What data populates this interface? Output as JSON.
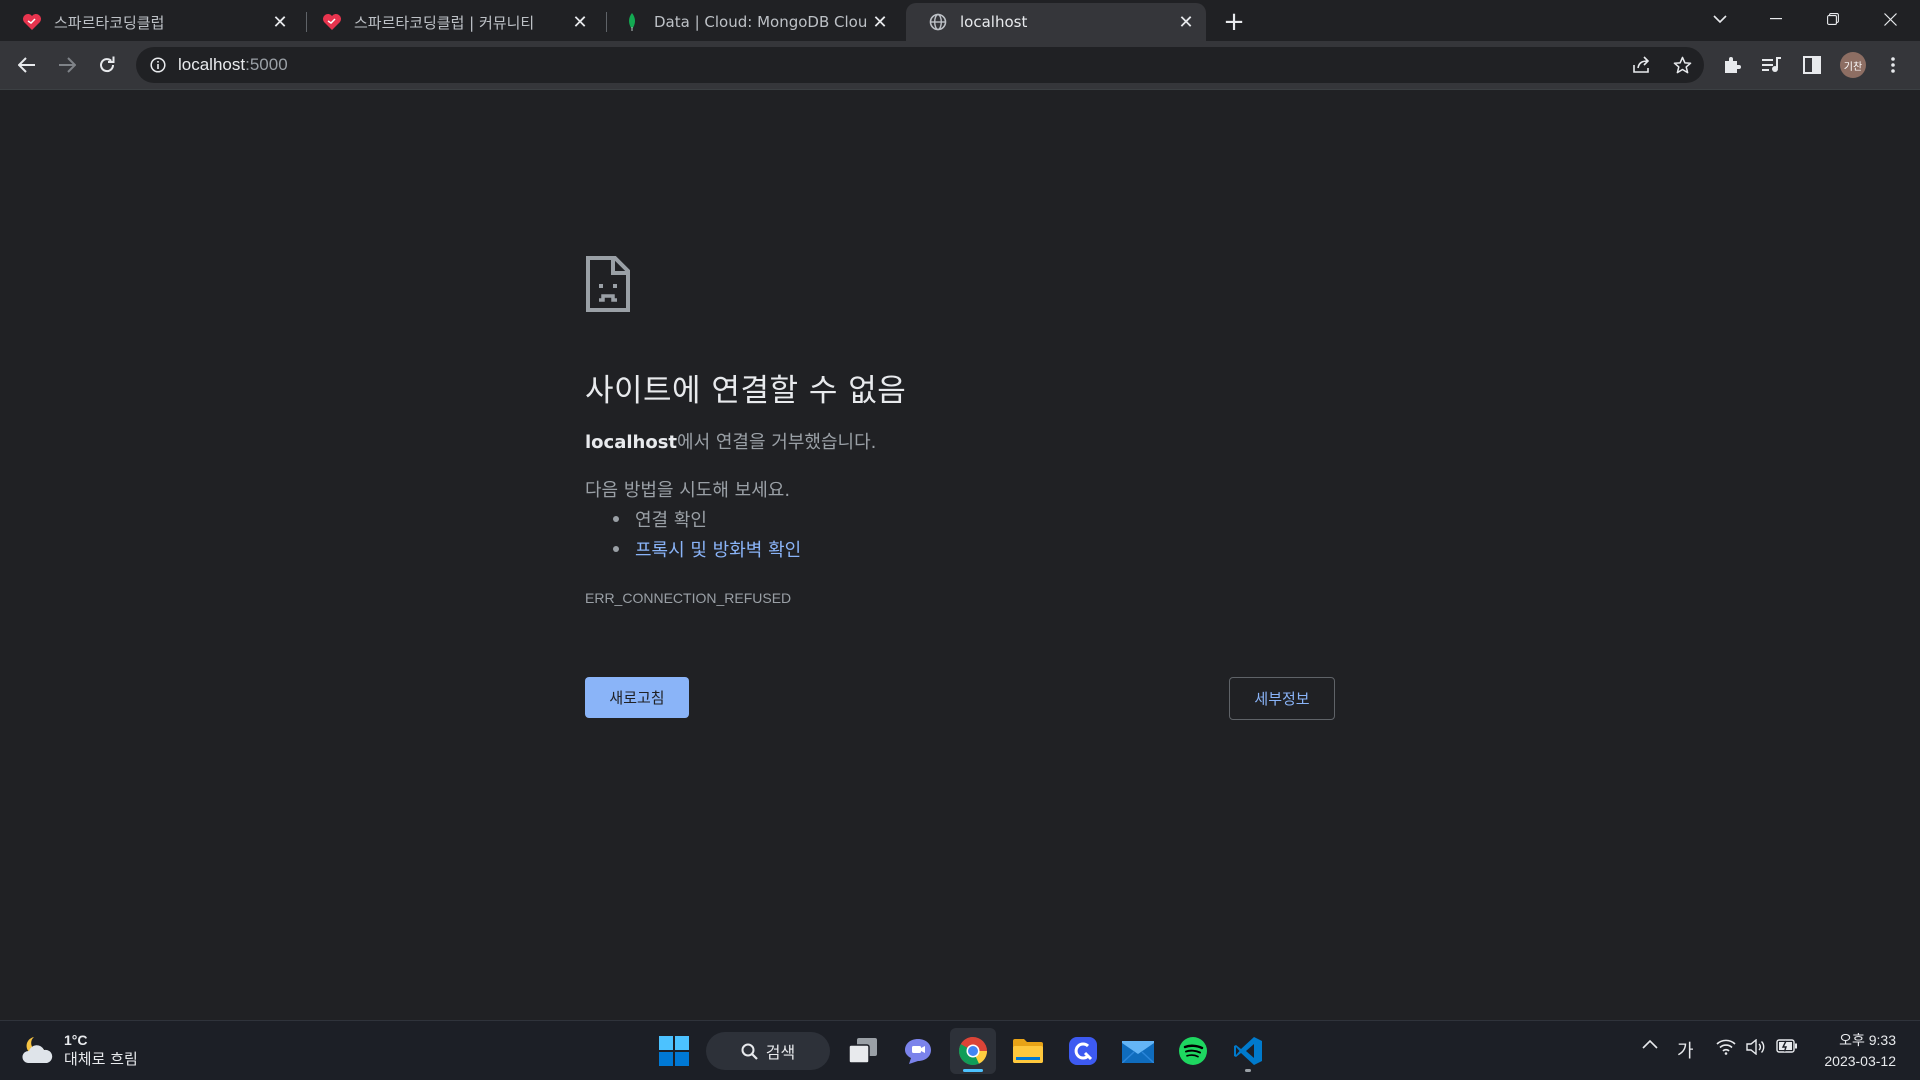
{
  "tabs": [
    {
      "title": "스파르타코딩클럽",
      "icon": "spartacoding-heart-icon"
    },
    {
      "title": "스파르타코딩클럽 | 커뮤니티",
      "icon": "spartacoding-heart-icon"
    },
    {
      "title": "Data | Cloud: MongoDB Cloud",
      "icon": "mongodb-leaf-icon"
    },
    {
      "title": "localhost",
      "icon": "globe-icon",
      "active": true
    }
  ],
  "address_bar": {
    "host": "localhost",
    "port": ":5000"
  },
  "profile": {
    "initials": "기찬"
  },
  "error_page": {
    "heading": "사이트에 연결할 수 없음",
    "host": "localhost",
    "description_suffix": "에서 연결을 거부했습니다.",
    "try_text": "다음 방법을 시도해 보세요.",
    "suggestions": [
      {
        "text": "연결 확인",
        "link": false
      },
      {
        "text": "프록시 및 방화벽 확인",
        "link": true
      }
    ],
    "error_code": "ERR_CONNECTION_REFUSED",
    "reload_label": "새로고침",
    "details_label": "세부정보"
  },
  "taskbar": {
    "weather_temp": "1°C",
    "weather_desc": "대체로 흐림",
    "search_label": "검색",
    "ime_label": "가",
    "clock_time": "오후 9:33",
    "clock_date": "2023-03-12"
  },
  "colors": {
    "page_bg": "#202124",
    "toolbar_bg": "#35363a",
    "accent": "#8ab4f8"
  }
}
